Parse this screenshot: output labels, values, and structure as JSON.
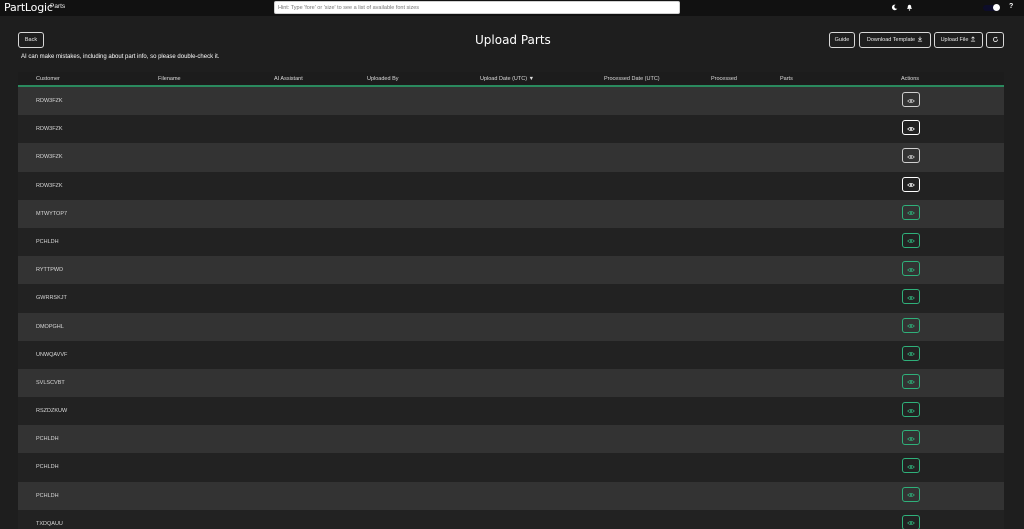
{
  "app": {
    "logo_prefix": "P",
    "logo_rest": "artLogic",
    "section": "Parts"
  },
  "search": {
    "placeholder": "Hint: Type 'fore' or 'size' to see a list of available font sizes"
  },
  "toolbar": {
    "back_label": "Back",
    "title": "Upload Parts",
    "guide_label": "Guide",
    "template_label": "Download Template",
    "upload_label": "Upload File"
  },
  "warning": "AI can make mistakes, including about part info, so please double-check it.",
  "columns": [
    {
      "label": "Customer"
    },
    {
      "label": "Filename"
    },
    {
      "label": "AI Assistant"
    },
    {
      "label": "Uploaded By"
    },
    {
      "label": "Upload Date (UTC) ▼"
    },
    {
      "label": "Processed Date (UTC)"
    },
    {
      "label": "Processed"
    },
    {
      "label": "Parts"
    },
    {
      "label": "Actions"
    }
  ],
  "rows": [
    {
      "customer": "RDW3FZK",
      "action_style": "neutral"
    },
    {
      "customer": "RDW3FZK",
      "action_style": "light"
    },
    {
      "customer": "RDW3FZK",
      "action_style": "neutral"
    },
    {
      "customer": "RDW3FZK",
      "action_style": "light"
    },
    {
      "customer": "MTWYTOP7",
      "action_style": "accent"
    },
    {
      "customer": "PCHLDH",
      "action_style": "accent"
    },
    {
      "customer": "RYTTPWD",
      "action_style": "accent"
    },
    {
      "customer": "GWRRSKJT",
      "action_style": "accent"
    },
    {
      "customer": "DMOPGHL",
      "action_style": "accent"
    },
    {
      "customer": "UNWQAVVF",
      "action_style": "accent"
    },
    {
      "customer": "SVLSCVBT",
      "action_style": "accent"
    },
    {
      "customer": "RSZDZKUW",
      "action_style": "accent"
    },
    {
      "customer": "PCHLDH",
      "action_style": "accent"
    },
    {
      "customer": "PCHLDH",
      "action_style": "accent"
    },
    {
      "customer": "PCHLDH",
      "action_style": "accent"
    },
    {
      "customer": "TXDQAUU",
      "action_style": "accent"
    }
  ],
  "colors": {
    "background": "#1e1e1e",
    "topbar": "#111111",
    "row_odd": "#333333",
    "row_even": "#222222",
    "accent": "#2fb07a"
  },
  "icons": {
    "theme": "moon-icon",
    "notifications": "bell-icon",
    "help": "?",
    "download": "download-icon",
    "upload": "upload-icon",
    "refresh": "refresh-icon",
    "view": "eye-icon"
  }
}
